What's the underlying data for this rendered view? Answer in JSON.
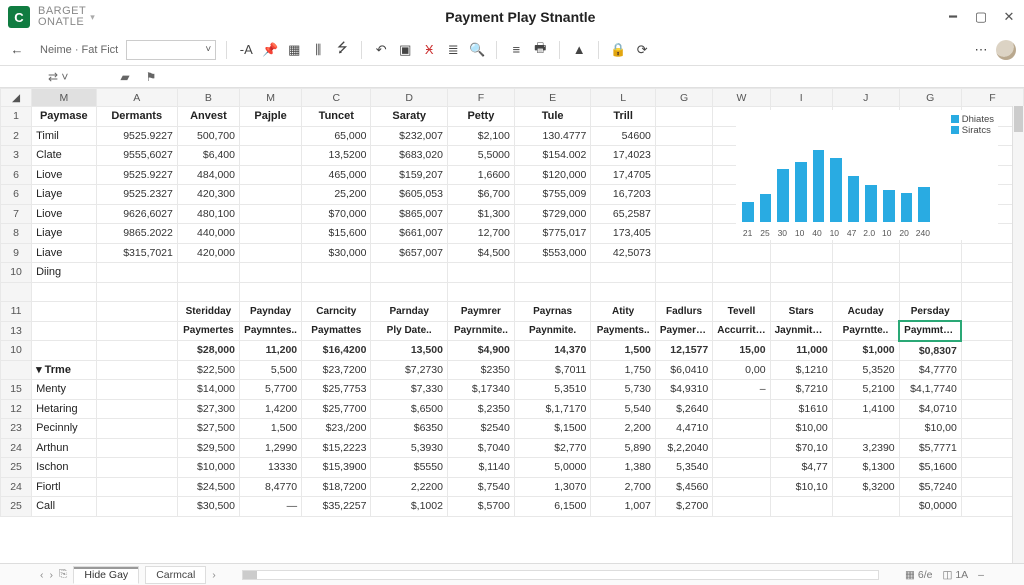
{
  "titlebar": {
    "brand1": "Barget",
    "brand2": "Onatle",
    "logo_letter": "C",
    "doc_title": "Payment Play Stnantle"
  },
  "toolbar": {
    "name_label": "Neime · Fat Fict",
    "name_box_chev": "˅",
    "font_dec": "-A"
  },
  "columns": [
    "",
    "M",
    "A",
    "B",
    "M",
    "C",
    "D",
    "F",
    "E",
    "L",
    "G",
    "W",
    "I",
    "J",
    "G",
    "F"
  ],
  "section1": {
    "headers": [
      "Paymase",
      "Dermants",
      "Anvest",
      "Pajple",
      "Tuncet",
      "Saraty",
      "Petty",
      "Tule",
      "Trill"
    ],
    "rows": [
      {
        "r": "2",
        "label": "Timil",
        "A": "9525.9227",
        "B": "500,700",
        "M": "",
        "C": "65,000",
        "D": "$232,007",
        "F": "$2,100",
        "E": "130.4777",
        "L": "54600"
      },
      {
        "r": "3",
        "label": "Clate",
        "A": "9555,6027",
        "B": "$6,400",
        "M": "",
        "C": "13,5200",
        "D": "$683,020",
        "F": "5,5000",
        "E": "$154.002",
        "L": "17,4023"
      },
      {
        "r": "6",
        "label": "Liove",
        "A": "9525.9227",
        "B": "484,000",
        "M": "",
        "C": "465,000",
        "D": "$159,207",
        "F": "1,6600",
        "E": "$120,000",
        "L": "17,4705"
      },
      {
        "r": "6",
        "label": "Liaye",
        "A": "9525.2327",
        "B": "420,300",
        "M": "",
        "C": "25,200",
        "D": "$605,053",
        "F": "$6,700",
        "E": "$755,009",
        "L": "16,7203"
      },
      {
        "r": "7",
        "label": "Liove",
        "A": "9626,6027",
        "B": "480,100",
        "M": "",
        "C": "$70,000",
        "D": "$865,007",
        "F": "$1,300",
        "E": "$729,000",
        "L": "65,2587"
      },
      {
        "r": "8",
        "label": "Liaye",
        "A": "9865.2022",
        "B": "440,000",
        "M": "",
        "C": "$15,600",
        "D": "$661,007",
        "F": "12,700",
        "E": "$775,017",
        "L": "173,405"
      },
      {
        "r": "9",
        "label": "Liave",
        "A": "$315,7021",
        "B": "420,000",
        "M": "",
        "C": "$30,000",
        "D": "$657,007",
        "F": "$4,500",
        "E": "$553,000",
        "L": "42,5073"
      },
      {
        "r": "10",
        "label": "Diing",
        "A": "",
        "B": "",
        "M": "",
        "C": "",
        "D": "",
        "F": "",
        "E": "",
        "L": ""
      }
    ]
  },
  "section2": {
    "headers1": [
      "",
      "Steridday",
      "Paynday",
      "Carncity",
      "Parnday",
      "Paymrer",
      "Payrnas",
      "Atity",
      "Fadlurs",
      "Tevell",
      "Stars",
      "Acuday",
      "Persday"
    ],
    "headers2": [
      "",
      "Paymertes",
      "Paymntes..",
      "Paymattes",
      "Ply Date..",
      "Payrnmite..",
      "Paynmite.",
      "Payments..",
      "Paymertes..",
      "Accurrite..",
      "Jaynmites..",
      "Payrntte..",
      "Paymmtes.."
    ],
    "rows": [
      {
        "r": "10",
        "lbl": "",
        "v": [
          "$28,000",
          "11,200",
          "$16,4200",
          "13,500",
          "$4,900",
          "14,370",
          "1,500",
          "12,1577",
          "15,00",
          "11,000",
          "$1,000",
          "$0,8307"
        ]
      },
      {
        "r": "",
        "lbl": "Trme",
        "collapse": true,
        "v": [
          "$22,500",
          "5,500",
          "$23,7200",
          "$7,2730",
          "$2350",
          "$,7011",
          "1,750",
          "$6,0410",
          "0,00",
          "$,1210",
          "5,3520",
          "$4,7770"
        ]
      },
      {
        "r": "15",
        "lbl": "Menty",
        "v": [
          "$14,000",
          "5,7700",
          "$25,7753",
          "$7,330",
          "$,17340",
          "5,3510",
          "5,730",
          "$4,9310",
          "–",
          "$,7210",
          "5,2100",
          "$4,1,7740"
        ]
      },
      {
        "r": "12",
        "lbl": "Hetaring",
        "v": [
          "$27,300",
          "1,4200",
          "$25,7700",
          "$,6500",
          "$,2350",
          "$,1,7170",
          "5,540",
          "$,2640",
          "",
          "$1610",
          "1,4100",
          "$4,0710"
        ]
      },
      {
        "r": "23",
        "lbl": "Pecinnly",
        "v": [
          "$27,500",
          "1,500",
          "$23,/200",
          "$6350",
          "$2540",
          "$,1500",
          "2,200",
          "4,4710",
          "",
          "$10,00",
          "",
          "$10,00"
        ]
      },
      {
        "r": "24",
        "lbl": "Arthun",
        "v": [
          "$29,500",
          "1,2990",
          "$15,2223",
          "5,3930",
          "$,7040",
          "$2,770",
          "5,890",
          "$,2,2040",
          "",
          "$70,10",
          "3,2390",
          "$5,7771"
        ]
      },
      {
        "r": "25",
        "lbl": "Ischon",
        "v": [
          "$10,000",
          "13330",
          "$15,3900",
          "$5550",
          "$,1140",
          "5,0000",
          "1,380",
          "5,3540",
          "",
          "$4,77",
          "$,1300",
          "$5,1600"
        ]
      },
      {
        "r": "24",
        "lbl": "Fiortl",
        "v": [
          "$24,500",
          "8,4770",
          "$18,7200",
          "2,2200",
          "$,7540",
          "1,3070",
          "2,700",
          "$,4560",
          "",
          "$10,10",
          "$,3200",
          "$5,7240"
        ]
      },
      {
        "r": "25",
        "lbl": "Call",
        "v": [
          "$30,500",
          "—",
          "$35,2257",
          "$,1002",
          "$,5700",
          "6,1500",
          "1,007",
          "$,2700",
          "",
          "",
          "",
          "$0,0000"
        ]
      }
    ]
  },
  "chart_data": {
    "type": "bar",
    "legend": [
      "Dhiates",
      "Siratcs"
    ],
    "categories": [
      "21",
      "25",
      "30",
      "10",
      "40",
      "10",
      "47",
      "2.0",
      "10",
      "20",
      "240"
    ],
    "values": [
      22,
      30,
      58,
      65,
      78,
      70,
      50,
      40,
      35,
      32,
      38
    ],
    "ylim": [
      0,
      100
    ]
  },
  "sheets": {
    "tabs": [
      "Hide Gay",
      "Carmcal"
    ],
    "active": 0,
    "status": [
      "6/e",
      "1A"
    ]
  }
}
